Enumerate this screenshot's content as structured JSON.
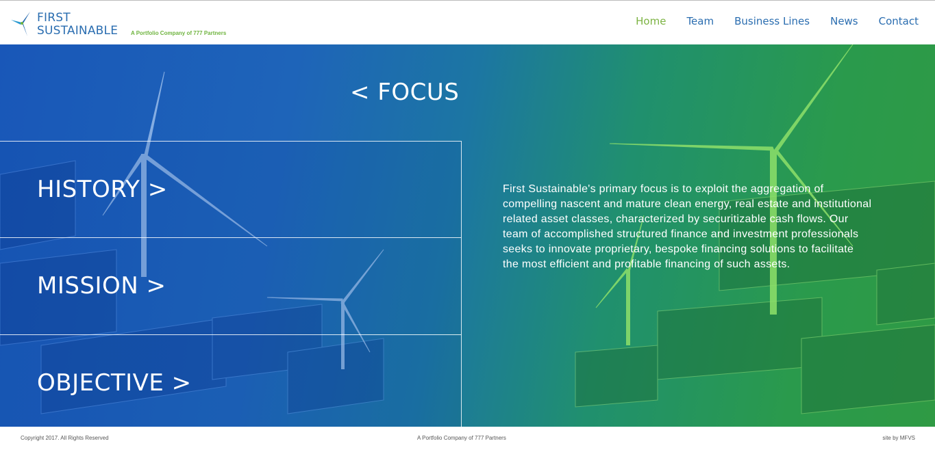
{
  "brand": {
    "line1": "FIRST",
    "line2": "SUSTAINABLE",
    "tagline": "A Portfolio Company of 777 Partners",
    "logo_icon": "wind-turbine-icon"
  },
  "nav": {
    "items": [
      "Home",
      "Team",
      "Business Lines",
      "News",
      "Contact"
    ],
    "active": "Home"
  },
  "hero": {
    "back_title": "< FOCUS",
    "menu": [
      "HISTORY >",
      "MISSION >",
      "OBJECTIVE >"
    ],
    "body": "First Sustainable's primary focus is to exploit the aggregation of compelling nascent and mature clean energy, real estate and institutional related asset classes, characterized by securitizable cash flows. Our team of accomplished structured finance and investment professionals seeks to innovate proprietary, bespoke financing solutions to facilitate the most efficient and profitable financing of such assets."
  },
  "footer": {
    "copyright": "Copyright 2017. All Rights Reserved",
    "center": "A Portfolio Company of 777 Partners",
    "credit": "site by MFVS"
  },
  "colors": {
    "brand_blue": "#2a6db0",
    "brand_green": "#7cb342",
    "hero_blue": "#1957b8",
    "hero_green": "#2f9a44"
  }
}
